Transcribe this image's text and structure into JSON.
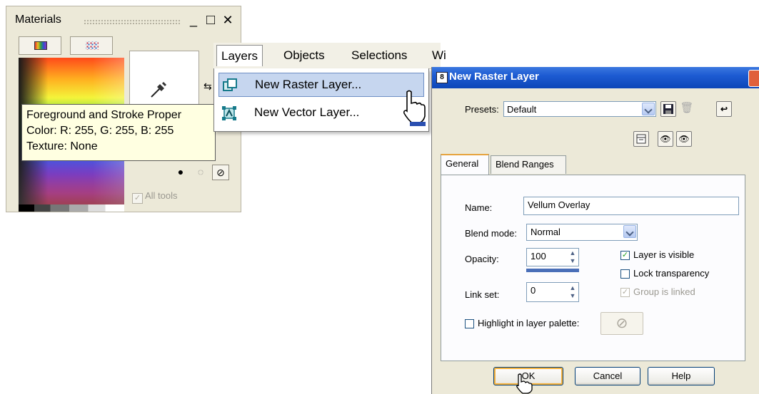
{
  "materials": {
    "title": "Materials",
    "min_glyph": "_",
    "max_glyph": "□",
    "close_glyph": "✕",
    "all_tools_label": "All tools",
    "tooltip": {
      "line1": "Foreground and Stroke Proper",
      "line2": "Color: R: 255, G: 255, B: 255",
      "line3": "Texture: None"
    }
  },
  "menubar": {
    "items": [
      "Layers",
      "Objects",
      "Selections",
      "Wi"
    ]
  },
  "layers_menu": {
    "items": [
      "New Raster Layer...",
      "New Vector Layer..."
    ]
  },
  "dialog": {
    "title": "New Raster Layer",
    "presets_label": "Presets:",
    "presets_value": "Default",
    "tabs": [
      "General",
      "Blend Ranges"
    ],
    "name_label": "Name:",
    "name_value": "Vellum Overlay",
    "blend_mode_label": "Blend mode:",
    "blend_mode_value": "Normal",
    "opacity_label": "Opacity:",
    "opacity_value": "100",
    "link_set_label": "Link set:",
    "link_set_value": "0",
    "layer_visible_label": "Layer is visible",
    "lock_transparency_label": "Lock transparency",
    "group_linked_label": "Group is linked",
    "highlight_label": "Highlight in layer palette:",
    "ok_label": "OK",
    "cancel_label": "Cancel",
    "help_label": "Help",
    "layer_visible_checked": true,
    "lock_transparency_checked": false,
    "group_linked_checked": true,
    "highlight_checked": false
  },
  "colors": {
    "caption_blue": "#1d5bd2",
    "menu_highlight": "#c6d6ef",
    "tooltip_bg": "#ffffe1",
    "default_button_ring": "#f8b33c"
  }
}
